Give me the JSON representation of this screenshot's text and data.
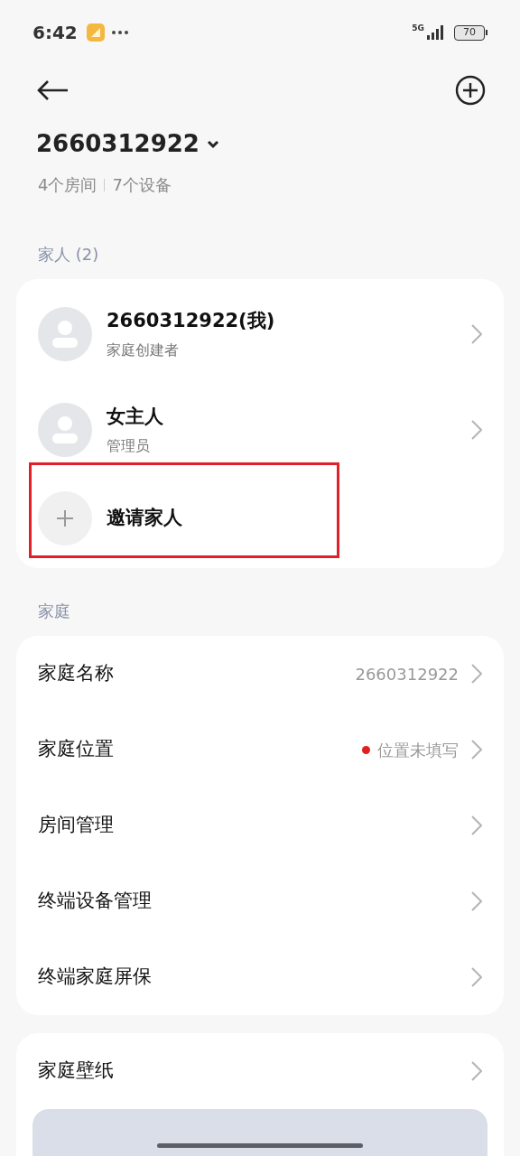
{
  "status_bar": {
    "time": "6:42",
    "network": "5G",
    "battery": "70"
  },
  "home": {
    "title": "2660312922",
    "rooms": "4个房间",
    "devices": "7个设备"
  },
  "members_section": {
    "title": "家人 (2)",
    "members": [
      {
        "name": "2660312922(我)",
        "role": "家庭创建者"
      },
      {
        "name": "女主人",
        "role": "管理员"
      }
    ],
    "invite": {
      "label": "邀请家人",
      "highlighted": true
    }
  },
  "family_section": {
    "title": "家庭",
    "rows": [
      {
        "kind": "value",
        "label": "家庭名称",
        "value": "2660312922"
      },
      {
        "kind": "status",
        "label": "家庭位置",
        "value": "位置未填写",
        "color": "#e02020"
      },
      {
        "kind": "plain",
        "label": "房间管理"
      },
      {
        "kind": "plain",
        "label": "终端设备管理"
      },
      {
        "kind": "plain",
        "label": "终端家庭屏保"
      }
    ]
  },
  "wallpaper": {
    "label": "家庭壁纸"
  }
}
